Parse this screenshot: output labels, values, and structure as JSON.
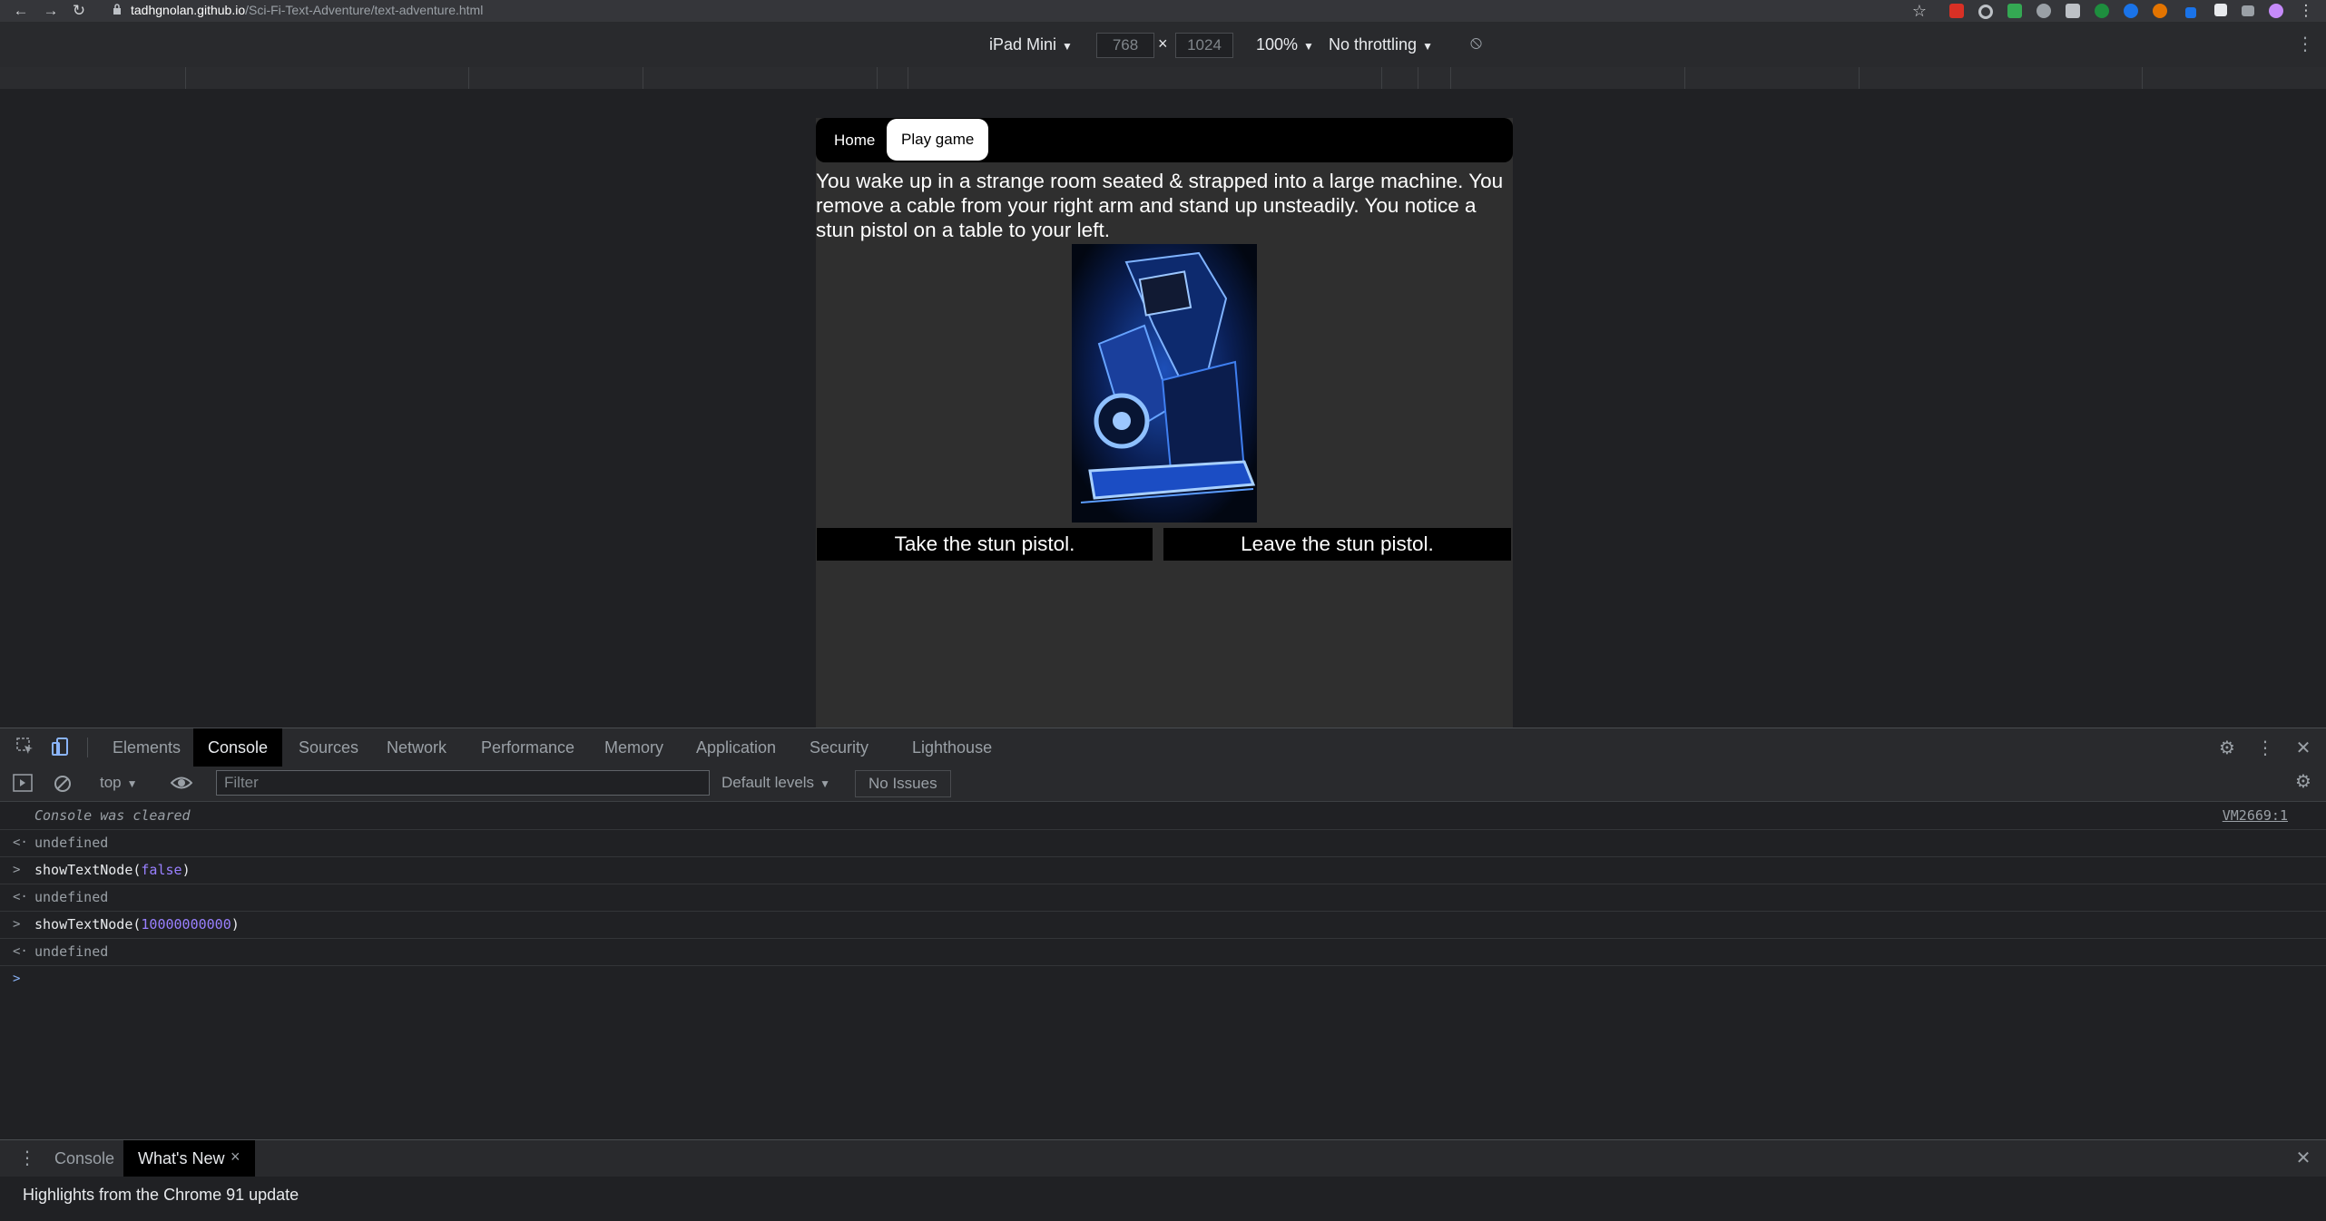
{
  "browser": {
    "url_host": "tadhgnolan.github.io",
    "url_path": "/Sci-Fi-Text-Adventure/text-adventure.html",
    "back_icon": "←",
    "forward_icon": "→",
    "reload_icon": "↻",
    "star_icon": "☆",
    "menu_icon": "⋮"
  },
  "device_toolbar": {
    "device": "iPad Mini",
    "width": "768",
    "height": "1024",
    "times": "×",
    "zoom": "100%",
    "throttling": "No throttling",
    "rotate_icon": "⦸",
    "more_icon": "⋮"
  },
  "site": {
    "nav_home": "Home",
    "nav_play": "Play game",
    "story_text": "You wake up in a strange room seated & strapped into a large machine. You remove a cable from your right arm and stand up unsteadily. You notice a stun pistol on a table to your left.",
    "option_1": "Take the stun pistol.",
    "option_2": "Leave the stun pistol."
  },
  "devtools": {
    "tabs": [
      "Elements",
      "Console",
      "Sources",
      "Network",
      "Performance",
      "Memory",
      "Application",
      "Security",
      "Lighthouse"
    ],
    "active_tab": "Console",
    "context": "top",
    "filter_placeholder": "Filter",
    "levels": "Default levels",
    "issues": "No Issues",
    "settings_icon": "⚙",
    "more_icon": "⋮",
    "close_icon": "✕"
  },
  "console": {
    "cleared": "Console was cleared",
    "vm_link": "VM2669:1",
    "return_prefix": "<·",
    "input_prefix": ">",
    "undefined": "undefined",
    "cmd1_fn": "showTextNode(",
    "cmd1_arg": "false",
    "cmd1_close": ")",
    "cmd2_fn": "showTextNode(",
    "cmd2_arg": "10000000000",
    "cmd2_close": ")",
    "prompt": ">"
  },
  "drawer": {
    "tabs": [
      "Console",
      "What's New"
    ],
    "active_tab": "What's New",
    "tab_close": "×",
    "highlight": "Highlights from the Chrome 91 update",
    "menu_icon": "⋮",
    "close_icon": "✕"
  },
  "colors": {
    "devtools_bg": "#202124",
    "panel_bg": "#292a2d",
    "page_bg": "#2f2f2f",
    "accent_blue": "#8ab4f8"
  }
}
